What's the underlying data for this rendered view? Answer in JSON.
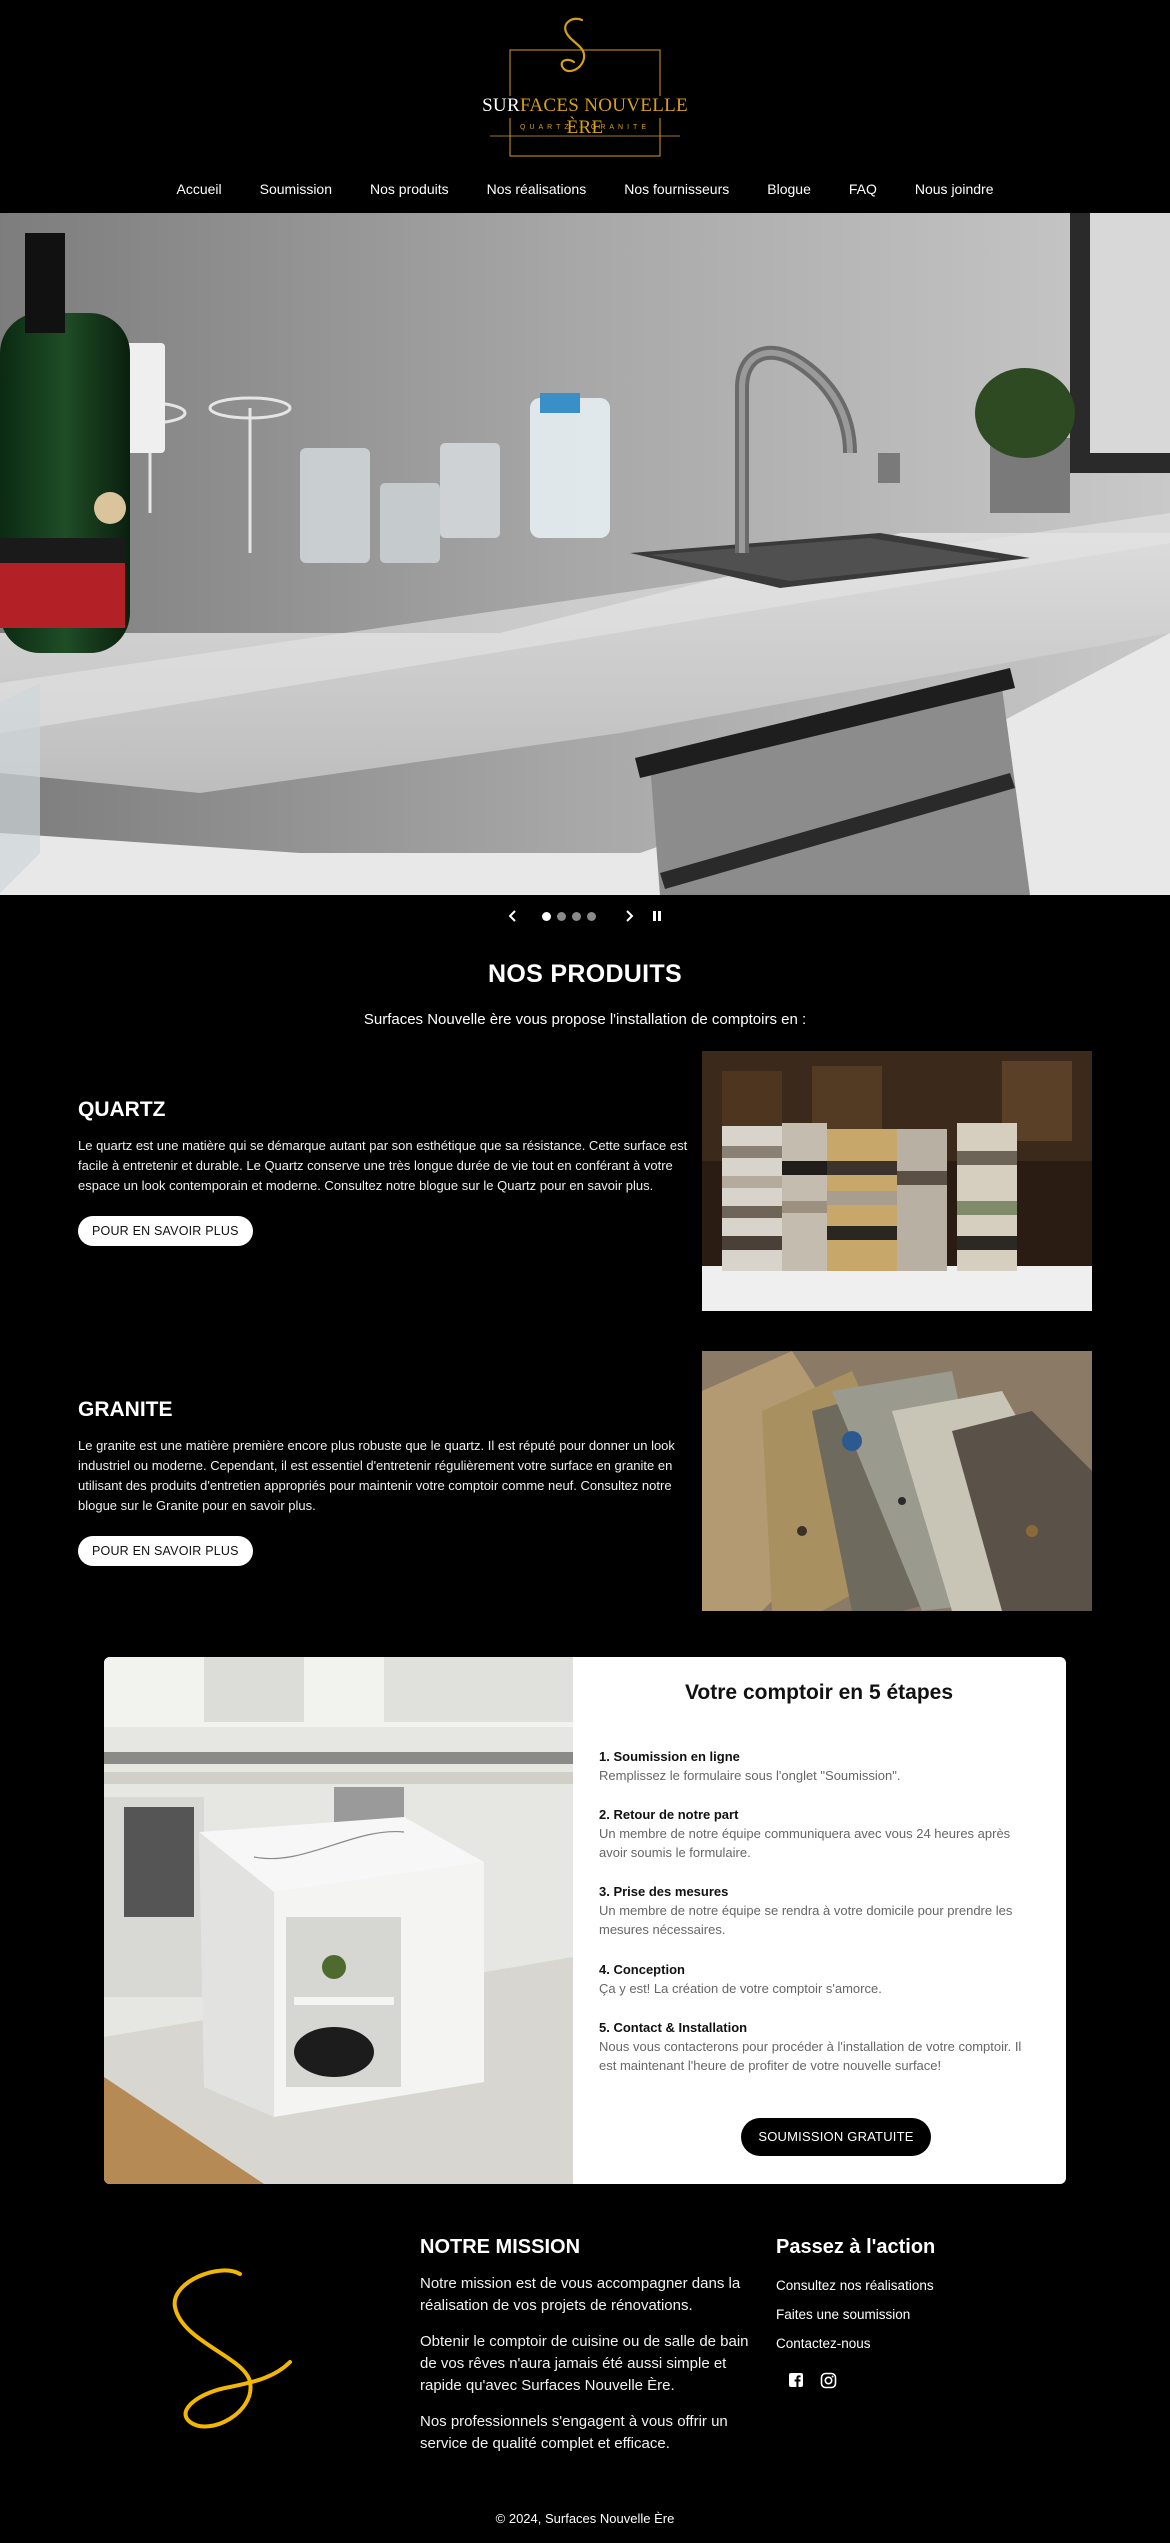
{
  "brand": {
    "name_part1": "SUR",
    "name_part2": "FACES NOUVELLE ÈRE",
    "tagline": "QUARTZ · GRANITE",
    "gold": "#d4a017"
  },
  "nav": {
    "items": [
      "Accueil",
      "Soumission",
      "Nos produits",
      "Nos réalisations",
      "Nos fournisseurs",
      "Blogue",
      "FAQ",
      "Nous joindre"
    ]
  },
  "carousel": {
    "prev_icon": "chevron-left-icon",
    "next_icon": "chevron-right-icon",
    "pause_icon": "pause-icon",
    "slide_count": 4,
    "active_slide": 1
  },
  "products": {
    "title": "NOS PRODUITS",
    "subtitle": "Surfaces Nouvelle ère vous propose l'installation de comptoirs en :",
    "items": [
      {
        "name": "QUARTZ",
        "description": "Le quartz est une matière qui se démarque autant par son esthétique que sa résistance. Cette surface est facile à entretenir et durable. Le Quartz conserve une très longue durée de vie tout en conférant à votre espace un look contemporain et moderne. Consultez notre blogue sur le Quartz pour en savoir plus.",
        "button": "POUR EN SAVOIR PLUS"
      },
      {
        "name": "GRANITE",
        "description": "Le granite est une matière première encore plus robuste que le quartz. Il est réputé pour donner un look industriel ou moderne. Cependant, il est essentiel d'entretenir régulièrement votre surface en granite en utilisant des produits d'entretien appropriés pour maintenir votre comptoir comme neuf. Consultez notre blogue sur le Granite pour en savoir plus.",
        "button": "POUR EN SAVOIR PLUS"
      }
    ]
  },
  "steps": {
    "title": "Votre comptoir en 5 étapes",
    "items": [
      {
        "title": "1. Soumission en ligne",
        "desc": "Remplissez le formulaire sous l'onglet \"Soumission\"."
      },
      {
        "title": "2. Retour de notre part",
        "desc": "Un membre de notre équipe communiquera avec vous 24 heures après avoir soumis le formulaire."
      },
      {
        "title": "3. Prise des mesures",
        "desc": "Un membre de notre équipe se rendra à votre domicile pour prendre les mesures nécessaires."
      },
      {
        "title": "4. Conception",
        "desc": "Ça y est! La création de votre comptoir s'amorce."
      },
      {
        "title": "5. Contact & Installation",
        "desc": "Nous vous contacterons pour procéder à l'installation de votre comptoir. Il est maintenant l'heure de profiter de votre nouvelle surface!"
      }
    ],
    "cta": "SOUMISSION GRATUITE"
  },
  "footer": {
    "mission_title": "NOTRE MISSION",
    "mission_paragraphs": [
      "Notre mission est de vous accompagner dans la réalisation de vos projets de rénovations.",
      "Obtenir le comptoir de cuisine ou de salle de bain de vos rêves n'aura jamais été aussi simple et rapide qu'avec Surfaces Nouvelle Ère.",
      "Nos professionnels s'engagent à vous offrir un service de qualité complet et efficace."
    ],
    "action_title": "Passez à l'action",
    "action_links": [
      "Consultez nos réalisations",
      "Faites une soumission",
      "Contactez-nous"
    ],
    "social_icons": [
      "facebook-icon",
      "instagram-icon"
    ],
    "copyright": "© 2024, Surfaces Nouvelle Ère"
  }
}
